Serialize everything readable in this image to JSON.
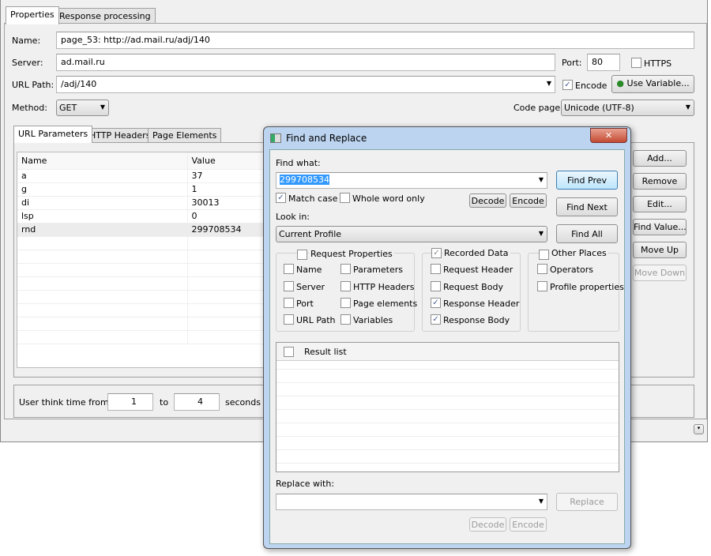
{
  "main": {
    "tabs": [
      "Properties",
      "Response processing"
    ],
    "name_label": "Name:",
    "name_value": "page_53: http://ad.mail.ru/adj/140",
    "server_label": "Server:",
    "server_value": "ad.mail.ru",
    "port_label": "Port:",
    "port_value": "80",
    "https_label": "HTTPS",
    "https_checked": false,
    "urlpath_label": "URL Path:",
    "urlpath_value": "/adj/140",
    "encode_label": "Encode",
    "encode_checked": true,
    "use_variable": "Use Variable...",
    "method_label": "Method:",
    "method_value": "GET",
    "codepage_label": "Code page:",
    "codepage_value": "Unicode (UTF-8)",
    "inner_tabs": [
      "URL Parameters",
      "HTTP Headers",
      "Page Elements"
    ],
    "columns": [
      "Name",
      "Value"
    ],
    "rows": [
      [
        "a",
        "37"
      ],
      [
        "g",
        "1"
      ],
      [
        "di",
        "30013"
      ],
      [
        "lsp",
        "0"
      ],
      [
        "rnd",
        "299708534"
      ]
    ],
    "buttons": {
      "add": "Add...",
      "remove": "Remove",
      "edit": "Edit...",
      "find_value": "Find Value...",
      "move_up": "Move Up",
      "move_down": "Move Down"
    },
    "think_label": "User think time from:",
    "think_from": "1",
    "think_to_label": "to",
    "think_to": "4",
    "think_unit": "seconds"
  },
  "dialog": {
    "title": "Find and Replace",
    "find_label": "Find what:",
    "find_value": "299708534",
    "find_prev": "Find Prev",
    "find_next": "Find Next",
    "find_all": "Find All",
    "match_case": "Match case",
    "whole_word": "Whole word only",
    "decode": "Decode",
    "encode": "Encode",
    "look_in_label": "Look in:",
    "look_in_value": "Current Profile",
    "groups": {
      "request": {
        "title": "Request Properties",
        "items": [
          "Name",
          "Parameters",
          "Server",
          "HTTP Headers",
          "Port",
          "Page elements",
          "URL Path",
          "Variables"
        ]
      },
      "recorded": {
        "title": "Recorded Data",
        "items": [
          "Request Header",
          "Request Body",
          "Response Header",
          "Response Body"
        ]
      },
      "other": {
        "title": "Other Places",
        "items": [
          "Operators",
          "Profile properties"
        ]
      }
    },
    "result_header": "Result list",
    "replace_label": "Replace with:",
    "replace_value": "",
    "replace_button": "Replace",
    "decode2": "Decode",
    "encode2": "Encode"
  }
}
